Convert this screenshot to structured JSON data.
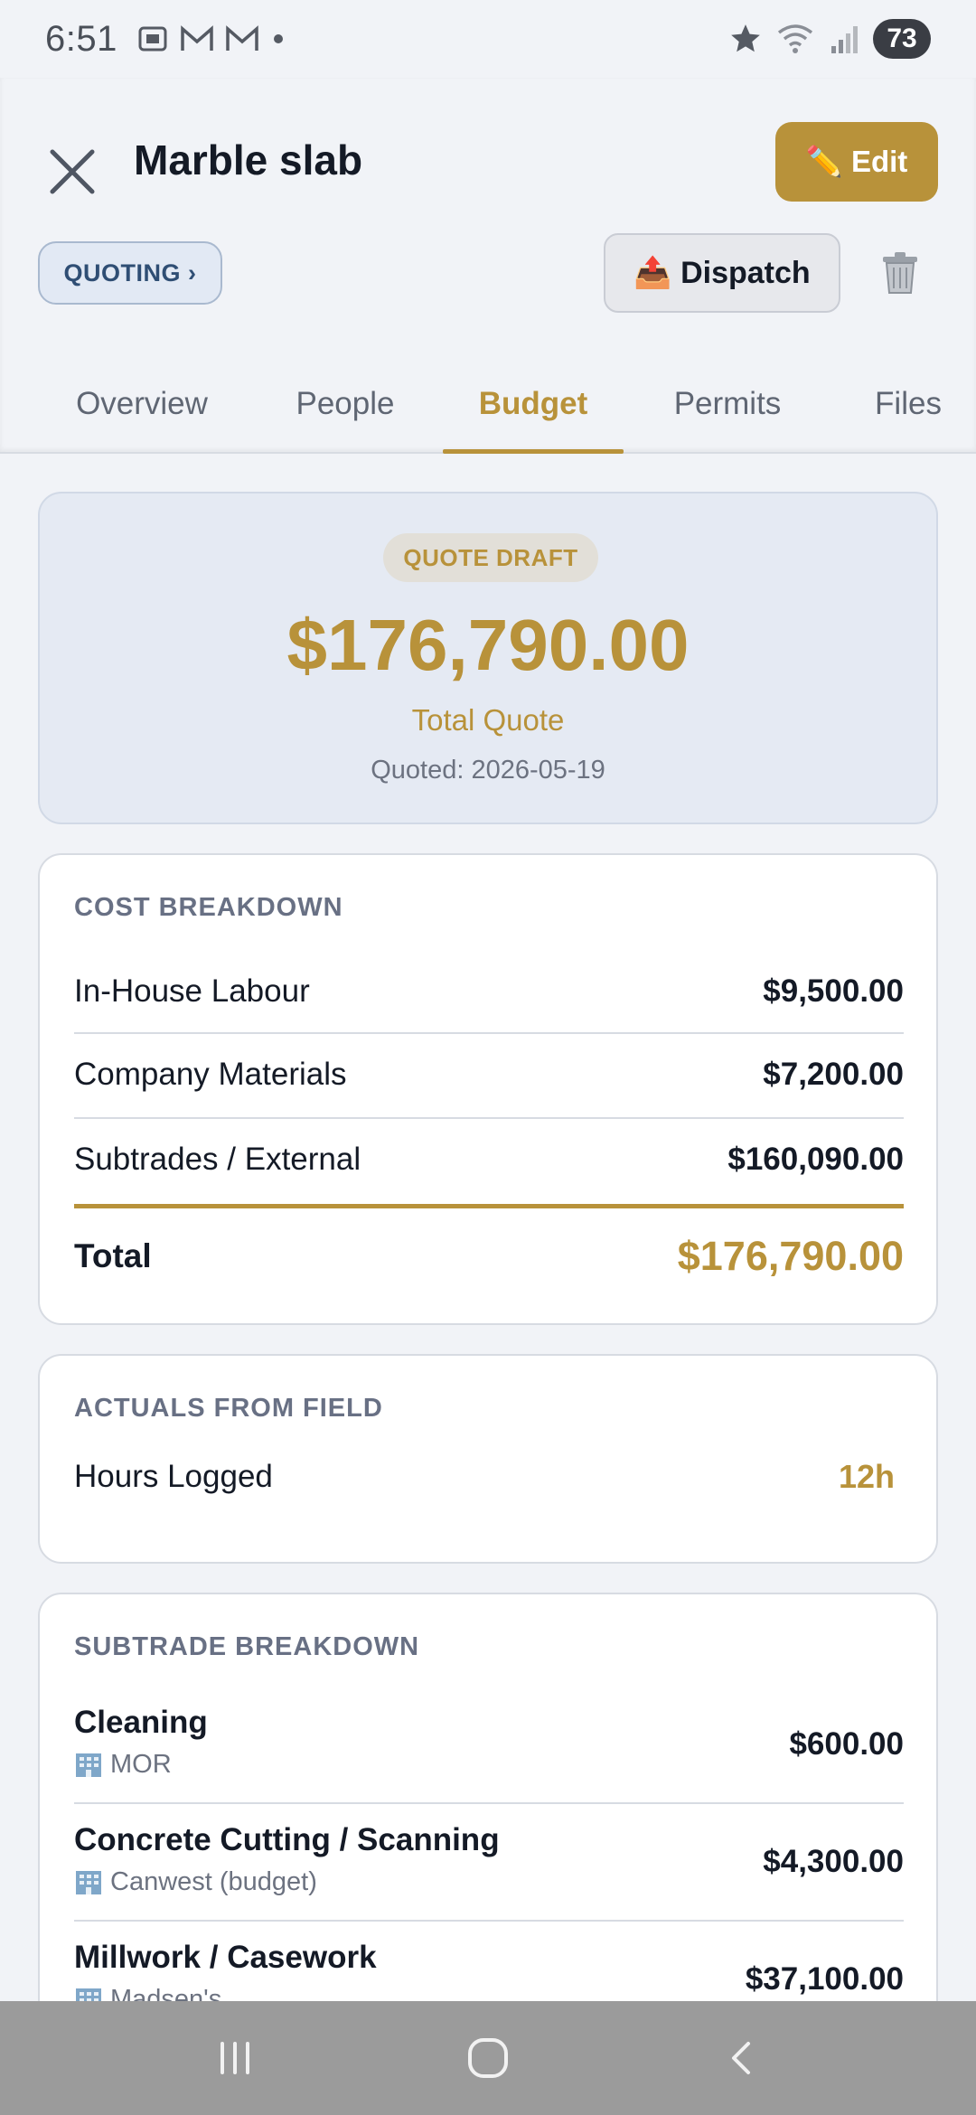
{
  "status_bar": {
    "time": "6:51",
    "battery": "73"
  },
  "header": {
    "title": "Marble slab",
    "edit_label": "✏️ Edit",
    "status_chip": "QUOTING ›",
    "dispatch_label": "📤 Dispatch"
  },
  "tabs": [
    {
      "label": "Overview",
      "active": false
    },
    {
      "label": "People",
      "active": false
    },
    {
      "label": "Budget",
      "active": true
    },
    {
      "label": "Permits",
      "active": false
    },
    {
      "label": "Files",
      "active": false
    }
  ],
  "quote": {
    "badge": "QUOTE DRAFT",
    "amount": "$176,790.00",
    "label": "Total Quote",
    "date": "Quoted: 2026-05-19"
  },
  "cost_breakdown": {
    "title": "COST BREAKDOWN",
    "rows": [
      {
        "label": "In-House Labour",
        "value": "$9,500.00"
      },
      {
        "label": "Company Materials",
        "value": "$7,200.00"
      },
      {
        "label": "Subtrades / External",
        "value": "$160,090.00"
      }
    ],
    "total_label": "Total",
    "total_value": "$176,790.00"
  },
  "actuals": {
    "title": "ACTUALS FROM FIELD",
    "hours_label": "Hours Logged",
    "hours_value": "12h"
  },
  "subtrades": {
    "title": "SUBTRADE BREAKDOWN",
    "items": [
      {
        "name": "Cleaning",
        "vendor": "MOR",
        "amount": "$600.00"
      },
      {
        "name": "Concrete Cutting / Scanning",
        "vendor": "Canwest (budget)",
        "amount": "$4,300.00"
      },
      {
        "name": "Millwork / Casework",
        "vendor": "Madsen's",
        "amount": "$37,100.00"
      }
    ]
  },
  "colors": {
    "accent": "#b8923a",
    "chip_text": "#2f4e74",
    "background": "#f1f3f7"
  }
}
